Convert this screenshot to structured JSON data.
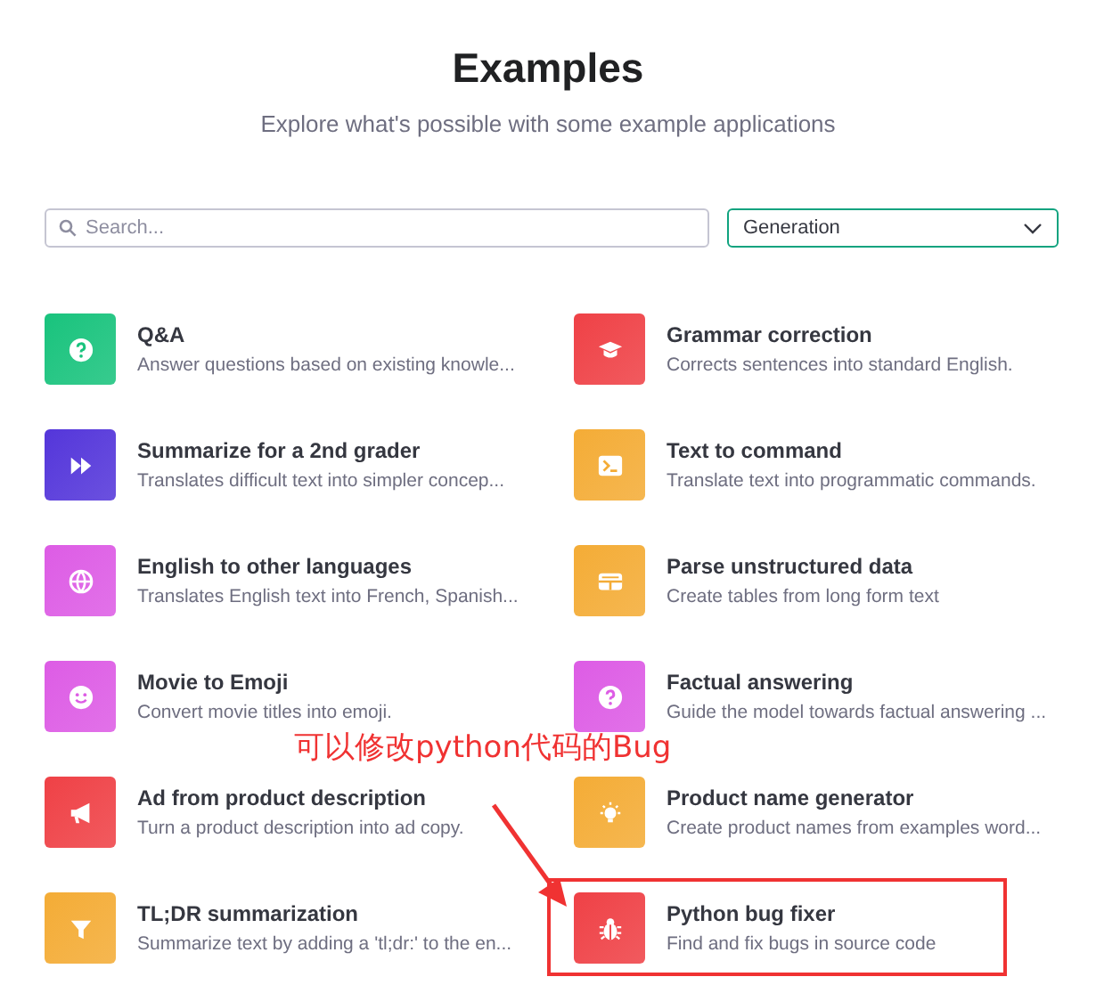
{
  "header": {
    "title": "Examples",
    "subtitle": "Explore what's possible with some example applications"
  },
  "search": {
    "placeholder": "Search..."
  },
  "category_select": {
    "value": "Generation"
  },
  "examples": [
    {
      "title": "Q&A",
      "description": "Answer questions based on existing knowle...",
      "color": "#19c37d",
      "highlighted": false
    },
    {
      "title": "Grammar correction",
      "description": "Corrects sentences into standard English.",
      "color": "#ef4146",
      "highlighted": false
    },
    {
      "title": "Summarize for a 2nd grader",
      "description": "Translates difficult text into simpler concep...",
      "color": "#5436da",
      "highlighted": false
    },
    {
      "title": "Text to command",
      "description": "Translate text into programmatic commands.",
      "color": "#f4ac36",
      "highlighted": false
    },
    {
      "title": "English to other languages",
      "description": "Translates English text into French, Spanish...",
      "color": "#dd5ce5",
      "highlighted": false
    },
    {
      "title": "Parse unstructured data",
      "description": "Create tables from long form text",
      "color": "#f4ac36",
      "highlighted": false
    },
    {
      "title": "Movie to Emoji",
      "description": "Convert movie titles into emoji.",
      "color": "#dd5ce5",
      "highlighted": false
    },
    {
      "title": "Factual answering",
      "description": "Guide the model towards factual answering ...",
      "color": "#dd5ce5",
      "highlighted": false
    },
    {
      "title": "Ad from product description",
      "description": "Turn a product description into ad copy.",
      "color": "#ef4146",
      "highlighted": false
    },
    {
      "title": "Product name generator",
      "description": "Create product names from examples word...",
      "color": "#f4ac36",
      "highlighted": false
    },
    {
      "title": "TL;DR summarization",
      "description": "Summarize text by adding a 'tl;dr:' to the en...",
      "color": "#f4ac36",
      "highlighted": false
    },
    {
      "title": "Python bug fixer",
      "description": "Find and fix bugs in source code",
      "color": "#ef4146",
      "highlighted": true
    }
  ],
  "annotation": {
    "text": "可以修改python代码的Bug"
  }
}
